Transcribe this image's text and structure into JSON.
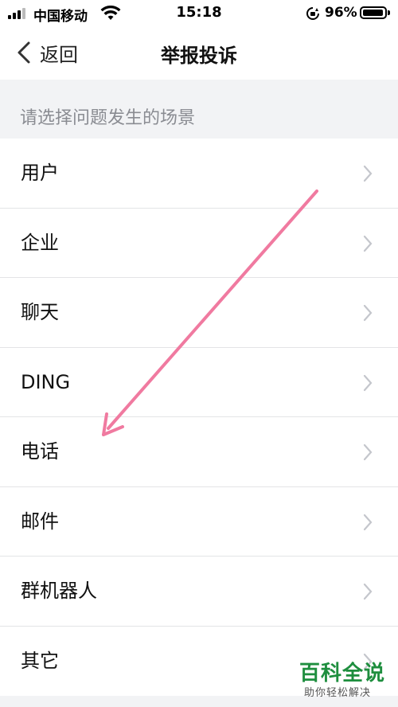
{
  "status_bar": {
    "carrier": "中国移动",
    "time": "15:18",
    "battery_percent_text": "96%",
    "battery_level": 0.96
  },
  "nav": {
    "back_label": "返回",
    "title": "举报投诉"
  },
  "section_header": "请选择问题发生的场景",
  "items": [
    {
      "label": "用户"
    },
    {
      "label": "企业"
    },
    {
      "label": "聊天"
    },
    {
      "label": "DING"
    },
    {
      "label": "电话"
    },
    {
      "label": "邮件"
    },
    {
      "label": "群机器人"
    },
    {
      "label": "其它"
    }
  ],
  "annotation": {
    "arrow_color": "#f07aa0"
  },
  "watermark": {
    "title": "百科全说",
    "subtitle": "助你轻松解决"
  },
  "colors": {
    "background": "#f2f3f5",
    "divider": "#e3e4e6",
    "chevron": "#c4c6cc",
    "secondary_text": "#8a8c92",
    "watermark_green": "#1e8e3e"
  }
}
